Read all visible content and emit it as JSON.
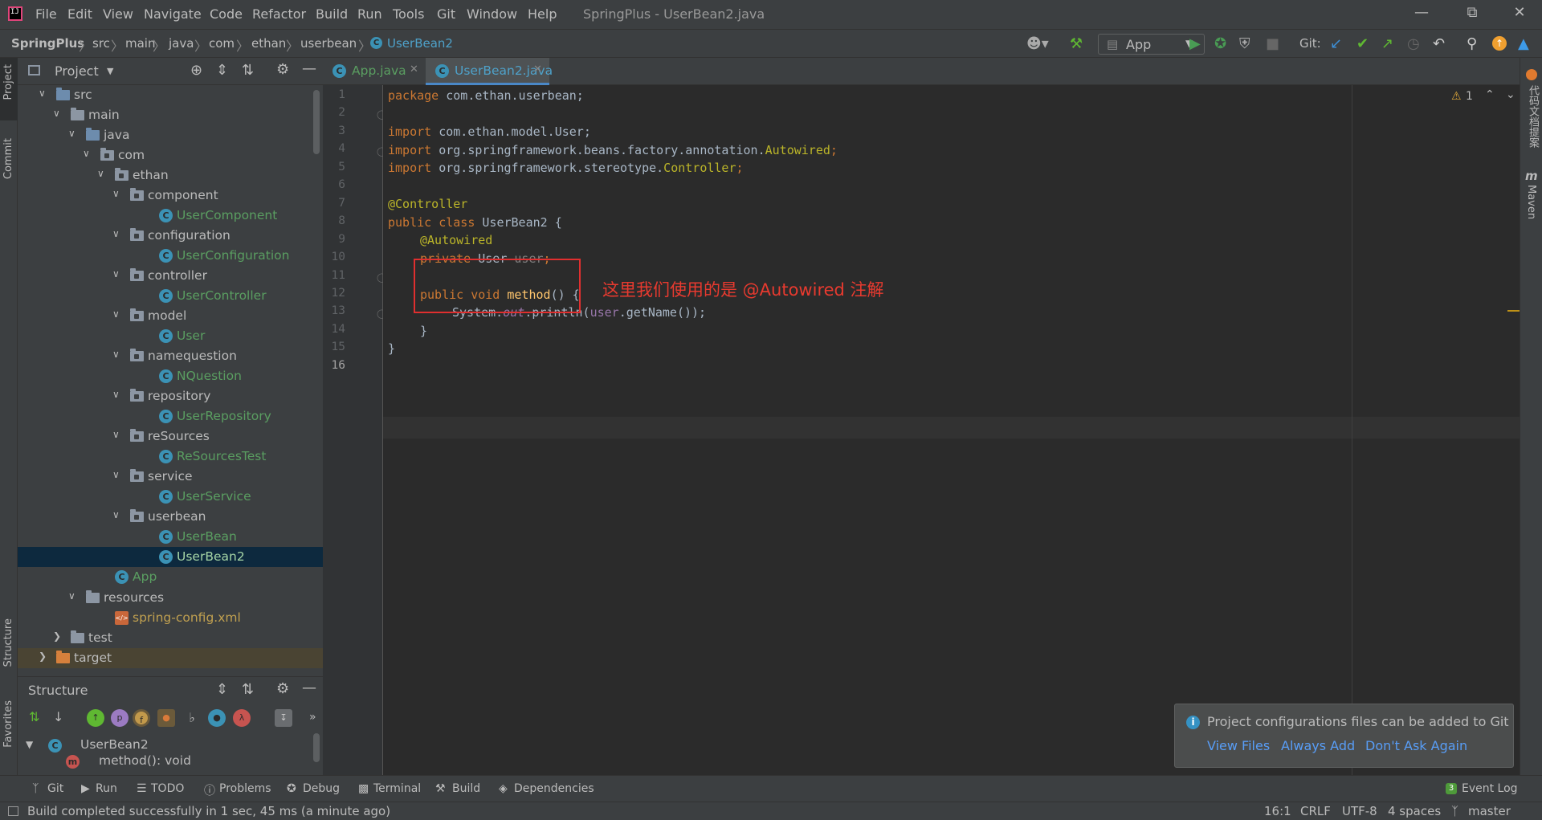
{
  "window": {
    "title": "SpringPlus - UserBean2.java",
    "menu": [
      "File",
      "Edit",
      "View",
      "Navigate",
      "Code",
      "Refactor",
      "Build",
      "Run",
      "Tools",
      "Git",
      "Window",
      "Help"
    ]
  },
  "breadcrumb": [
    "SpringPlus",
    "src",
    "main",
    "java",
    "com",
    "ethan",
    "userbean",
    "UserBean2"
  ],
  "toolbar": {
    "run_config": "App",
    "git_label": "Git:"
  },
  "left_strip": {
    "project": "Project",
    "commit": "Commit",
    "structure": "Structure",
    "favorites": "Favorites"
  },
  "project_panel": {
    "title": "Project",
    "tree": [
      {
        "label": "src",
        "type": "folder-src"
      },
      {
        "label": "main",
        "type": "folder"
      },
      {
        "label": "java",
        "type": "folder-src"
      },
      {
        "label": "com",
        "type": "package"
      },
      {
        "label": "ethan",
        "type": "package"
      },
      {
        "label": "component",
        "type": "package"
      },
      {
        "label": "UserComponent",
        "type": "class"
      },
      {
        "label": "configuration",
        "type": "package"
      },
      {
        "label": "UserConfiguration",
        "type": "class"
      },
      {
        "label": "controller",
        "type": "package"
      },
      {
        "label": "UserController",
        "type": "class"
      },
      {
        "label": "model",
        "type": "package"
      },
      {
        "label": "User",
        "type": "class"
      },
      {
        "label": "namequestion",
        "type": "package"
      },
      {
        "label": "NQuestion",
        "type": "class"
      },
      {
        "label": "repository",
        "type": "package"
      },
      {
        "label": "UserRepository",
        "type": "class"
      },
      {
        "label": "reSources",
        "type": "package"
      },
      {
        "label": "ReSourcesTest",
        "type": "class"
      },
      {
        "label": "service",
        "type": "package"
      },
      {
        "label": "UserService",
        "type": "class"
      },
      {
        "label": "userbean",
        "type": "package"
      },
      {
        "label": "UserBean",
        "type": "class"
      },
      {
        "label": "UserBean2",
        "type": "class"
      },
      {
        "label": "App",
        "type": "class"
      },
      {
        "label": "resources",
        "type": "folder"
      },
      {
        "label": "spring-config.xml",
        "type": "xml"
      },
      {
        "label": "test",
        "type": "folder"
      },
      {
        "label": "target",
        "type": "folder-orange"
      }
    ]
  },
  "structure_panel": {
    "title": "Structure",
    "root": "UserBean2",
    "member": "method(): void",
    "filter_badges": [
      "p",
      "f",
      "λ"
    ]
  },
  "editor": {
    "tabs": [
      "App.java",
      "UserBean2.java"
    ],
    "warning_count": "1",
    "line_numbers": [
      "1",
      "2",
      "3",
      "4",
      "5",
      "6",
      "7",
      "8",
      "9",
      "10",
      "11",
      "12",
      "13",
      "14",
      "15",
      "16"
    ],
    "code": {
      "l1_kw": "package",
      "l1_rest": " com.ethan.userbean;",
      "l3_kw": "import",
      "l3_rest": " com.ethan.model.User;",
      "l4_kw": "import",
      "l4_rest": " org.springframework.beans.factory.annotation.",
      "l4_ann": "Autowired",
      "l4_end": ";",
      "l5_kw": "import",
      "l5_rest": " org.springframework.stereotype.",
      "l5_ann": "Controller",
      "l5_end": ";",
      "l7": "@Controller",
      "l8_kw": "public class",
      "l8_rest": " UserBean2 {",
      "l9": "@Autowired",
      "l10_kw": "private",
      "l10_type": " User ",
      "l10_field": "user",
      "l10_end": ";",
      "l12_kw": "public void",
      "l12_fn": " method",
      "l12_end": "() {",
      "l13_a": "System.",
      "l13_out": "out",
      "l13_b": ".println(",
      "l13_user": "user",
      "l13_c": ".getName());",
      "l14": "}",
      "l15": "}"
    },
    "annotation_note": "这里我们使用的是 @Autowired 注解"
  },
  "right_strip": {
    "plugin": "代码文档提案",
    "maven": "Maven"
  },
  "notification": {
    "message": "Project configurations files can be added to Git",
    "actions": [
      "View Files",
      "Always Add",
      "Don't Ask Again"
    ]
  },
  "tool_windows": [
    "Git",
    "Run",
    "TODO",
    "Problems",
    "Debug",
    "Terminal",
    "Build",
    "Dependencies"
  ],
  "event_log": {
    "label": "Event Log",
    "count": "3"
  },
  "status": {
    "message": "Build completed successfully in 1 sec, 45 ms (a minute ago)",
    "position": "16:1",
    "line_sep": "CRLF",
    "encoding": "UTF-8",
    "indent": "4 spaces",
    "branch": "master"
  },
  "colors": {
    "accent": "#4a88c7",
    "keyword": "#cc7832",
    "annotation": "#bbb529",
    "highlight_box": "#e02f2f"
  }
}
